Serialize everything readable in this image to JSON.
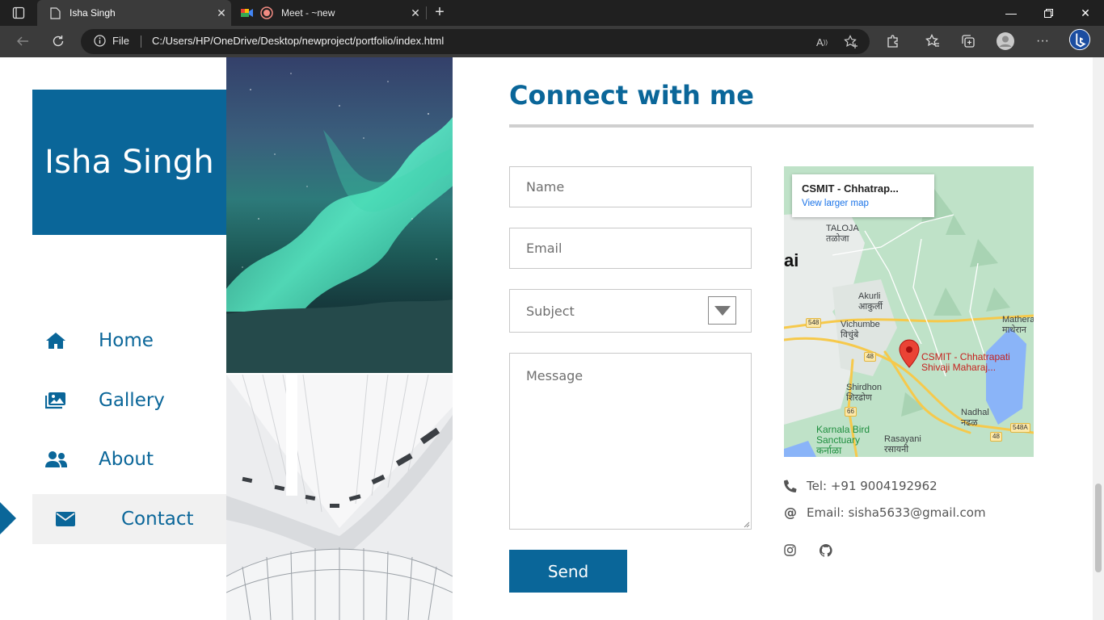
{
  "browser": {
    "tabs": [
      {
        "title": "Isha Singh",
        "active": true
      },
      {
        "title": "Meet - ~new",
        "active": false
      }
    ],
    "address": {
      "scheme_label": "File",
      "url": "C:/Users/HP/OneDrive/Desktop/newproject/portfolio/index.html"
    },
    "icons": [
      "back-icon",
      "refresh-icon",
      "info-icon",
      "read-aloud-icon",
      "add-favorite-icon",
      "extensions-icon",
      "favorites-icon",
      "collections-icon",
      "profile-icon",
      "more-icon",
      "bing-icon"
    ]
  },
  "sidebar": {
    "brand": "Isha Singh",
    "nav": [
      {
        "label": "Home",
        "icon": "home-icon",
        "active": false
      },
      {
        "label": "Gallery",
        "icon": "gallery-icon",
        "active": false
      },
      {
        "label": "About",
        "icon": "users-icon",
        "active": false
      },
      {
        "label": "Contact",
        "icon": "envelope-icon",
        "active": true
      }
    ]
  },
  "contact": {
    "heading": "Connect with me",
    "form": {
      "name_placeholder": "Name",
      "email_placeholder": "Email",
      "subject_placeholder": "Subject",
      "message_placeholder": "Message",
      "send_label": "Send"
    },
    "map": {
      "card_title": "CSMIT - Chhatrap...",
      "card_link": "View larger map",
      "pin_label_1": "CSMIT - Chhatrapati",
      "pin_label_2": "Shivaji Maharaj...",
      "places": {
        "taloja": "TALOJA",
        "taloja_local": "तळोजा",
        "ai": "ai",
        "akurli": "Akurli",
        "akurli_local": "आकुर्ली",
        "vichumbe": "Vichumbe",
        "vichumbe_local": "विचुंबे",
        "mathera": "Mathera",
        "mathera_local": "माथेरान",
        "shirdhon": "Shirdhon",
        "shirdhon_local": "शिरढोण",
        "nadhal": "Nadhal",
        "nadhal_local": "नढळ",
        "karnala1": "Karnala Bird",
        "karnala2": "Sanctuary",
        "karnala_local": "कर्नाळा",
        "rasayani": "Rasayani",
        "rasayani_local": "रसायनी"
      },
      "roads": {
        "r548": "548",
        "r48a": "48",
        "r48b": "48",
        "r66": "66",
        "r548a": "548A"
      }
    },
    "tel": "Tel: +91 9004192962",
    "email": "Email: sisha5633@gmail.com",
    "social": [
      "instagram-icon",
      "github-icon"
    ]
  },
  "colors": {
    "brand": "#0a6699",
    "accent_bg": "#f1f1f1"
  }
}
